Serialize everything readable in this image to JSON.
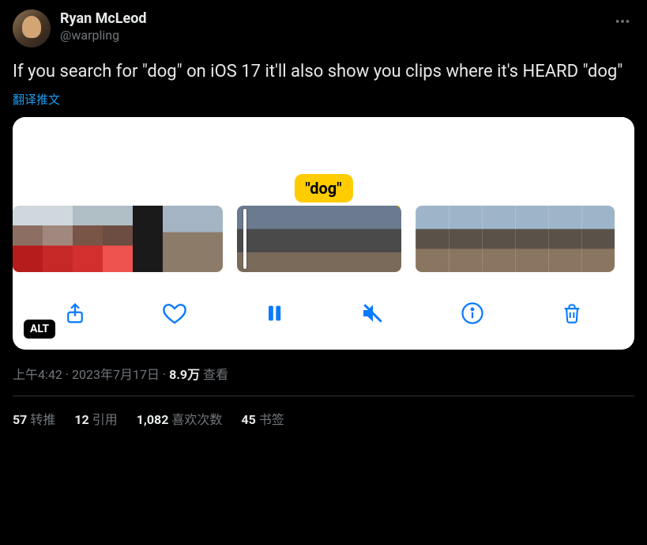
{
  "author": {
    "display_name": "Ryan McLeod",
    "handle": "@warpling"
  },
  "tweet_text": "If you search for \"dog\" on iOS 17 it'll also show you clips where it's HEARD \"dog\"",
  "translate_label": "翻译推文",
  "media": {
    "badge_text": "\"dog\"",
    "alt_label": "ALT",
    "toolbar": {
      "share": "share-icon",
      "like": "heart-icon",
      "pause": "pause-icon",
      "mute": "mute-icon",
      "info": "info-icon",
      "trash": "trash-icon"
    }
  },
  "meta": {
    "time": "上午4:42",
    "sep1": " · ",
    "date": "2023年7月17日",
    "sep2": " · ",
    "views_count": "8.9万",
    "views_label": " 查看"
  },
  "stats": {
    "retweets_count": "57",
    "retweets_label": "转推",
    "quotes_count": "12",
    "quotes_label": "引用",
    "likes_count": "1,082",
    "likes_label": "喜欢次数",
    "bookmarks_count": "45",
    "bookmarks_label": "书签"
  }
}
